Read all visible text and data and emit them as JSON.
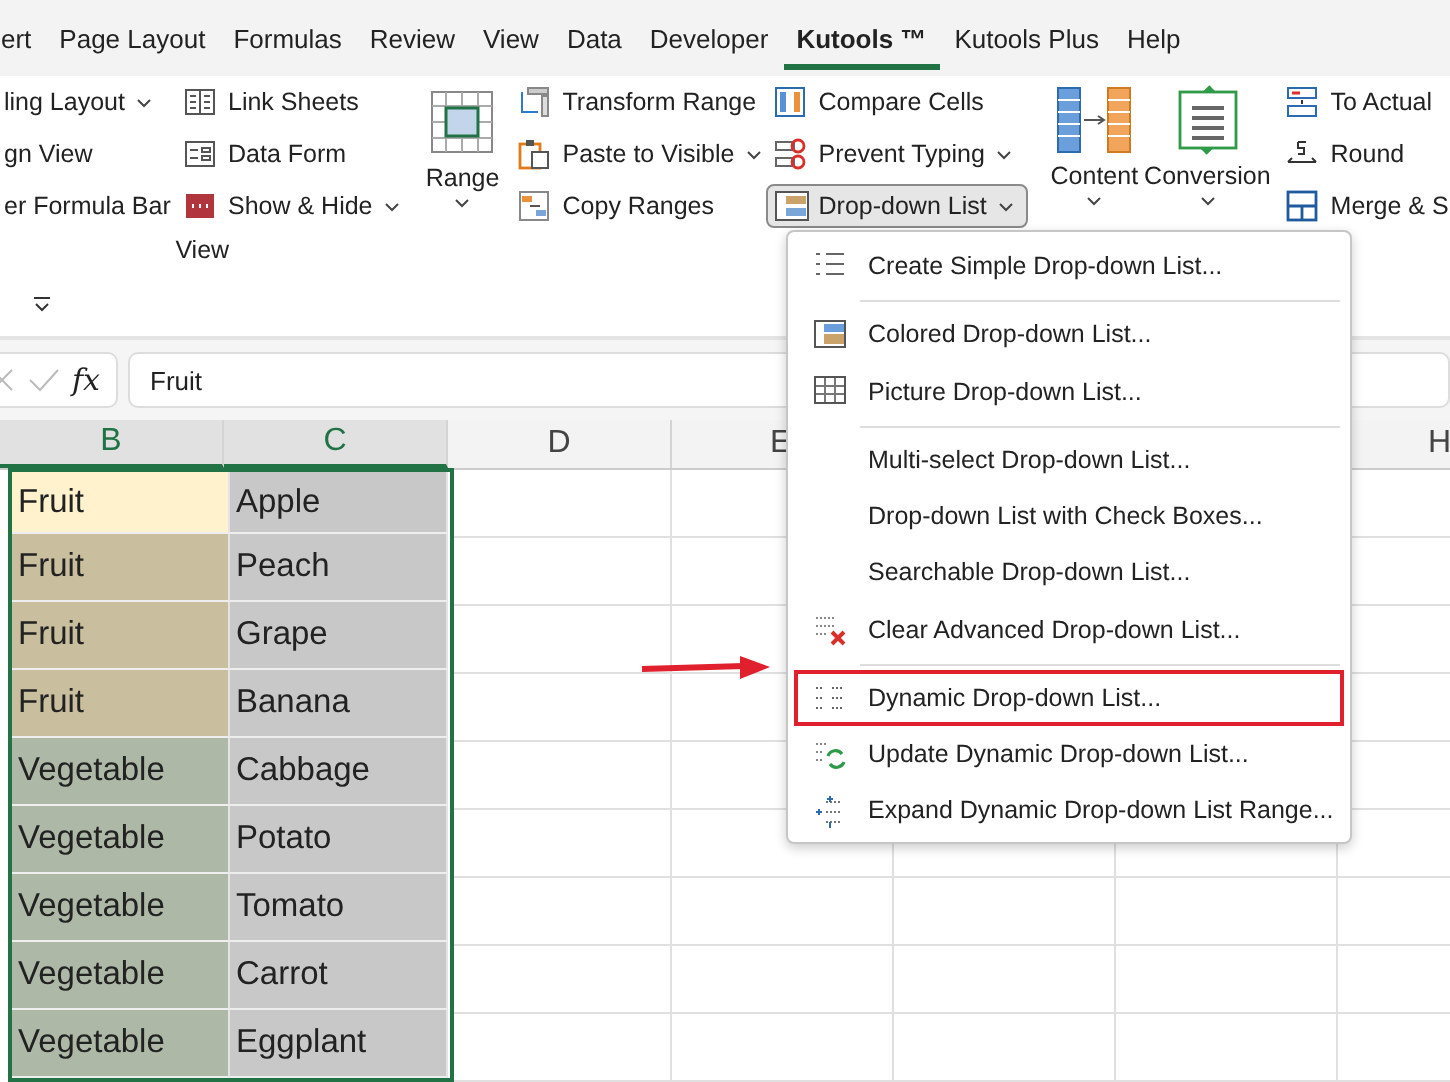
{
  "tabs": [
    {
      "label": "ert",
      "selected": false
    },
    {
      "label": "Page Layout",
      "selected": false
    },
    {
      "label": "Formulas",
      "selected": false
    },
    {
      "label": "Review",
      "selected": false
    },
    {
      "label": "View",
      "selected": false
    },
    {
      "label": "Data",
      "selected": false
    },
    {
      "label": "Developer",
      "selected": false
    },
    {
      "label": "Kutools ™",
      "selected": true
    },
    {
      "label": "Kutools Plus",
      "selected": false
    },
    {
      "label": "Help",
      "selected": false
    }
  ],
  "ribbon": {
    "view_group": {
      "label": "View",
      "columns": [
        [
          {
            "label": "ling Layout",
            "dropdown": true
          },
          {
            "label": "gn View",
            "dropdown": false
          },
          {
            "label": "er Formula Bar",
            "dropdown": false
          }
        ],
        [
          {
            "label": "Link Sheets",
            "dropdown": false
          },
          {
            "label": "Data Form",
            "dropdown": false
          },
          {
            "label": "Show & Hide",
            "dropdown": true
          }
        ]
      ]
    },
    "range_group": {
      "big": [
        {
          "label": "Range",
          "dropdown": true
        }
      ],
      "columns": [
        [
          {
            "label": "Transform Range",
            "dropdown": false
          },
          {
            "label": "Paste to Visible",
            "dropdown": true
          },
          {
            "label": "Copy Ranges",
            "dropdown": false
          }
        ],
        [
          {
            "label": "Compare Cells",
            "dropdown": false
          },
          {
            "label": "Prevent Typing",
            "dropdown": true
          },
          {
            "label": "Drop-down List",
            "dropdown": true,
            "pressed": true
          }
        ]
      ]
    },
    "convert_group": {
      "big": [
        {
          "label": "Content",
          "dropdown": true
        },
        {
          "label": "Conversion",
          "dropdown": true
        }
      ],
      "columns": [
        [
          {
            "label": "To Actual",
            "dropdown": false
          },
          {
            "label": "Round",
            "dropdown": false
          },
          {
            "label": "Merge & S",
            "dropdown": false
          }
        ]
      ]
    }
  },
  "formula_bar": {
    "fx": "fx",
    "value": "Fruit"
  },
  "sheet": {
    "columns": [
      {
        "label": "B",
        "selected": true
      },
      {
        "label": "C",
        "selected": true
      },
      {
        "label": "D",
        "selected": false
      },
      {
        "label": "E",
        "selected": false
      },
      {
        "label": "H",
        "selected": false
      }
    ],
    "rows": [
      {
        "b": "Fruit",
        "c": "Apple",
        "color": "#fff2cc"
      },
      {
        "b": "Fruit",
        "c": "Peach",
        "color": "#c9bf9e"
      },
      {
        "b": "Fruit",
        "c": "Grape",
        "color": "#c9bf9e"
      },
      {
        "b": "Fruit",
        "c": "Banana",
        "color": "#c9bf9e"
      },
      {
        "b": "Vegetable",
        "c": "Cabbage",
        "color": "#adb9a6"
      },
      {
        "b": "Vegetable",
        "c": "Potato",
        "color": "#adb9a6"
      },
      {
        "b": "Vegetable",
        "c": "Tomato",
        "color": "#adb9a6"
      },
      {
        "b": "Vegetable",
        "c": "Carrot",
        "color": "#adb9a6"
      },
      {
        "b": "Vegetable",
        "c": "Eggplant",
        "color": "#adb9a6"
      }
    ]
  },
  "menu": {
    "items": [
      {
        "label": "Create Simple Drop-down List...",
        "highlighted": false,
        "separator_after": true
      },
      {
        "label": "Colored Drop-down List...",
        "highlighted": false,
        "separator_after": false
      },
      {
        "label": "Picture Drop-down List...",
        "highlighted": false,
        "separator_after": true
      },
      {
        "label": "Multi-select Drop-down List...",
        "highlighted": false,
        "separator_after": false
      },
      {
        "label": "Drop-down List with Check Boxes...",
        "highlighted": false,
        "separator_after": false
      },
      {
        "label": "Searchable Drop-down List...",
        "highlighted": false,
        "separator_after": false
      },
      {
        "label": "Clear Advanced Drop-down List...",
        "highlighted": false,
        "separator_after": true
      },
      {
        "label": "Dynamic Drop-down List...",
        "highlighted": true,
        "separator_after": false
      },
      {
        "label": "Update Dynamic Drop-down List...",
        "highlighted": false,
        "separator_after": false
      },
      {
        "label": "Expand Dynamic Drop-down List Range...",
        "highlighted": false,
        "separator_after": false
      }
    ]
  }
}
